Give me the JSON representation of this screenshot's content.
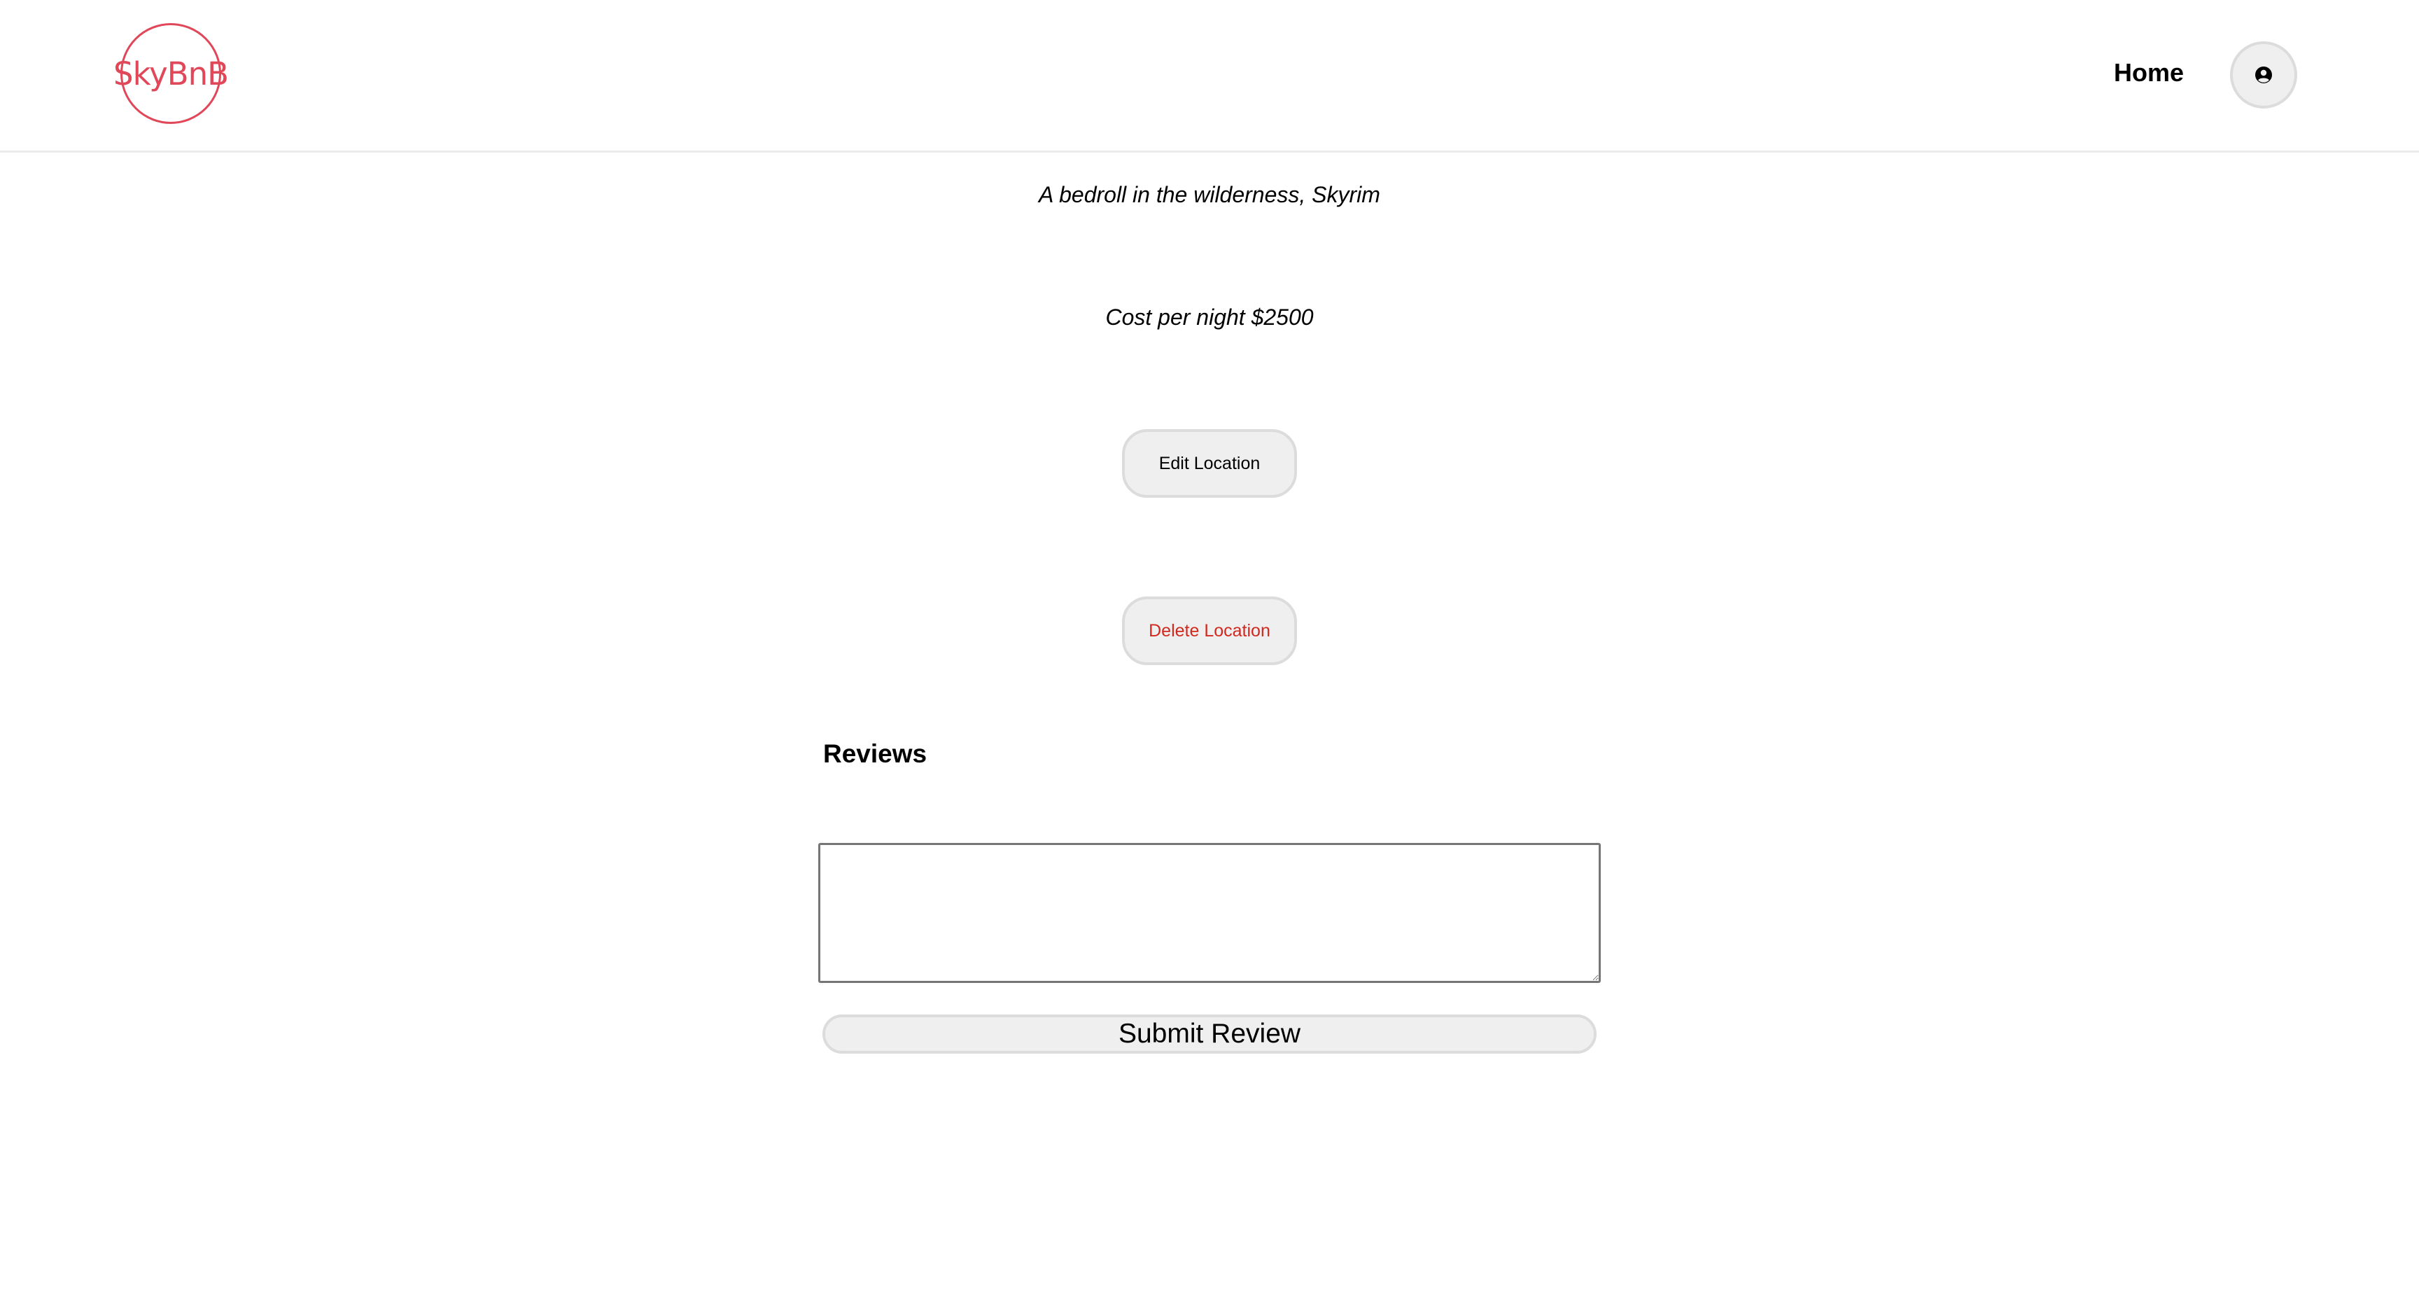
{
  "header": {
    "logo_text": "SkyBnB",
    "home_link": "Home",
    "profile_icon": "user-circle-icon"
  },
  "listing": {
    "subtitle": "A bedroll in the wilderness, Skyrim",
    "cost": "Cost per night $2500"
  },
  "actions": {
    "edit_label": "Edit Location",
    "delete_label": "Delete Location"
  },
  "reviews": {
    "heading": "Reviews",
    "textarea_value": "",
    "submit_label": "Submit Review"
  },
  "colors": {
    "brand": "#e0485a",
    "danger": "#d1291f",
    "button_bg": "#efefef",
    "button_border": "#dcdcdc"
  }
}
